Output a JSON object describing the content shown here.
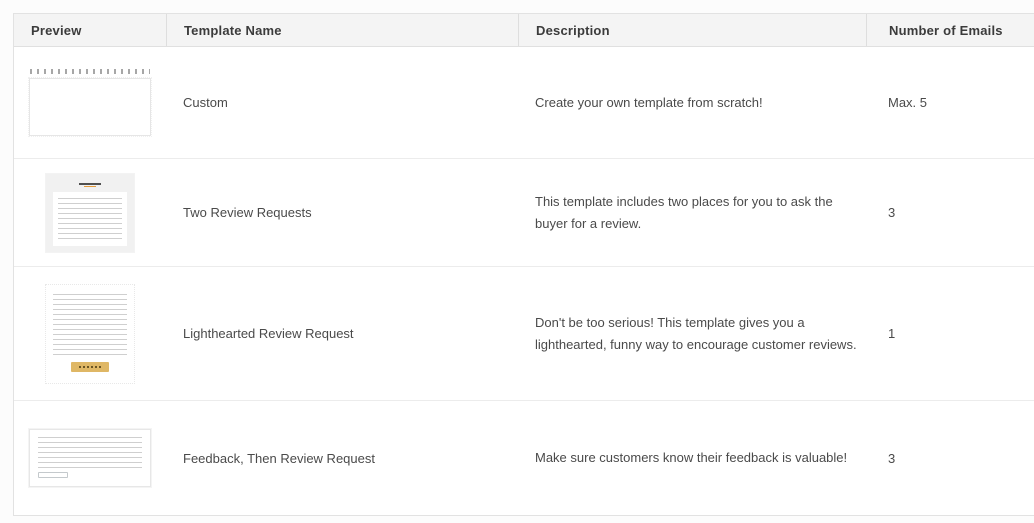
{
  "table": {
    "columns": [
      {
        "label": "Preview"
      },
      {
        "label": "Template Name"
      },
      {
        "label": "Description"
      },
      {
        "label": "Number of Emails"
      }
    ],
    "rows": [
      {
        "name": "Custom",
        "description": "Create your own template from scratch!",
        "emails": "Max. 5",
        "preview_icon": "blank-editor-thumbnail"
      },
      {
        "name": "Two Review Requests",
        "description": "This template includes two places for you to ask the buyer for a review.",
        "emails": "3",
        "preview_icon": "email-with-logo-thumbnail"
      },
      {
        "name": "Lighthearted Review Request",
        "description": "Don't be too serious! This template gives you a lighthearted, funny way to encourage customer reviews.",
        "emails": "1",
        "preview_icon": "email-with-gold-button-thumbnail"
      },
      {
        "name": "Feedback, Then Review Request",
        "description": "Make sure customers know their feedback is valuable!",
        "emails": "3",
        "preview_icon": "feedback-email-thumbnail"
      }
    ]
  },
  "colors": {
    "header_background": "#f4f4f4",
    "table_border": "#e2e2e2",
    "row_separator": "#ececec",
    "text": "#4a4a4a",
    "thumbnail_logo_accent": "#e59c3c",
    "thumbnail_button_gold": "#dfb765"
  }
}
